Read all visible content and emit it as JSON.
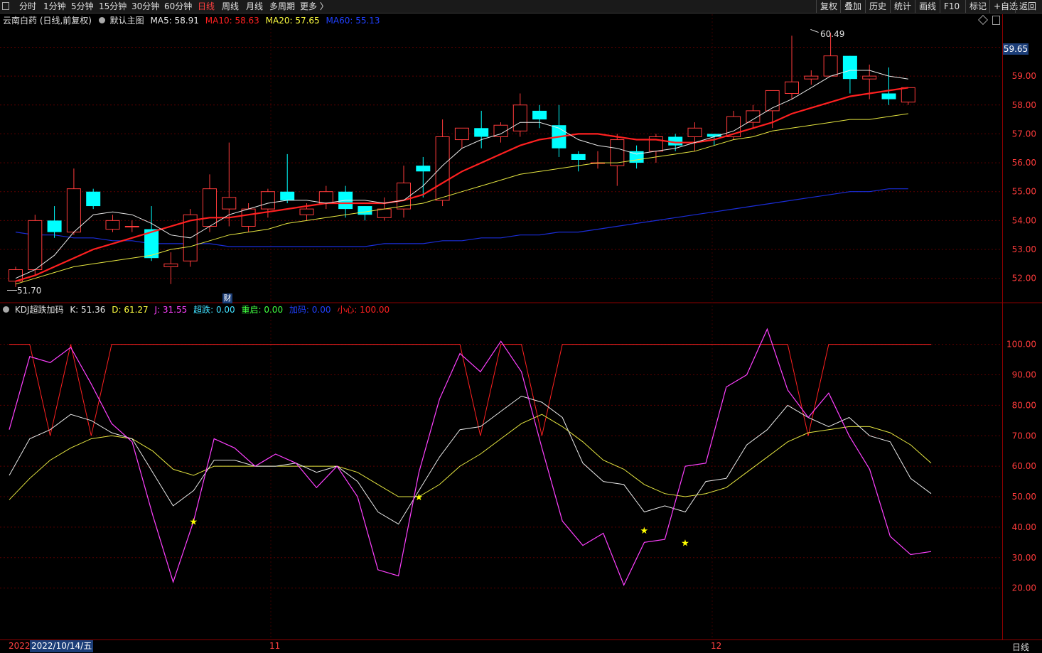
{
  "toolbar": {
    "periods": [
      "分时",
      "1分钟",
      "5分钟",
      "15分钟",
      "30分钟",
      "60分钟",
      "日线",
      "周线",
      "月线",
      "多周期",
      "更多 〉"
    ],
    "active_period": "日线",
    "right_buttons": [
      "复权",
      "叠加",
      "历史",
      "统计",
      "画线",
      "F10",
      "标记",
      "+自选",
      "返回"
    ]
  },
  "main_info": {
    "stock": "云南白药 (日线,前复权)",
    "template": "默认主图",
    "ma5": {
      "label": "MA5: 58.91",
      "color": "#e8e8e8"
    },
    "ma10": {
      "label": "MA10: 58.63",
      "color": "#ff2020"
    },
    "ma20": {
      "label": "MA20: 57.65",
      "color": "#ffff40"
    },
    "ma60": {
      "label": "MA60: 55.13",
      "color": "#2040ff"
    }
  },
  "kdj_info": {
    "title": "KDJ超跌加码",
    "k": {
      "label": "K: 51.36",
      "color": "#e8e8e8"
    },
    "d": {
      "label": "D: 61.27",
      "color": "#ffff40"
    },
    "j": {
      "label": "J: 31.55",
      "color": "#ff40ff"
    },
    "chaodie": {
      "label": "超跌: 0.00",
      "color": "#40e0ff"
    },
    "chongqi": {
      "label": "重启: 0.00",
      "color": "#40ff40"
    },
    "jiama": {
      "label": "加码: 0.00",
      "color": "#2040ff"
    },
    "xiaoxin": {
      "label": "小心: 100.00",
      "color": "#ff2020"
    }
  },
  "price_axis": {
    "ticks": [
      "59.00",
      "58.00",
      "57.00",
      "56.00",
      "55.00",
      "54.00",
      "53.00",
      "52.00"
    ],
    "current_price": "59.65",
    "high_label": "60.49",
    "low_label": "51.70"
  },
  "kdj_axis": {
    "ticks": [
      "100.00",
      "90.00",
      "80.00",
      "70.00",
      "60.00",
      "50.00",
      "40.00",
      "30.00",
      "20.00"
    ]
  },
  "finance_marker": "财",
  "bottom": {
    "start_label": "2022",
    "cursor_date": "2022/10/14/五",
    "month_labels": [
      "11",
      "12"
    ],
    "period_label": "日线"
  },
  "colors": {
    "up": "#ff3b3b",
    "down": "#00ffff",
    "grid": "#5a0000",
    "axis": "#8b0000"
  },
  "chart_data": {
    "type": "candlestick",
    "candles": [
      [
        51.9,
        52.3,
        51.7,
        52.4
      ],
      [
        52.3,
        54.0,
        52.1,
        54.2
      ],
      [
        54.0,
        53.6,
        53.4,
        54.5
      ],
      [
        53.6,
        55.1,
        53.5,
        55.8
      ],
      [
        55.0,
        54.5,
        54.4,
        55.1
      ],
      [
        53.7,
        54.0,
        53.6,
        54.2
      ],
      [
        53.8,
        53.8,
        53.6,
        54.0
      ],
      [
        53.7,
        52.7,
        52.6,
        54.5
      ],
      [
        52.4,
        52.5,
        51.8,
        52.9
      ],
      [
        52.6,
        54.2,
        52.4,
        54.4
      ],
      [
        53.8,
        55.1,
        53.6,
        55.6
      ],
      [
        54.4,
        54.8,
        53.8,
        56.7
      ],
      [
        53.8,
        54.4,
        53.6,
        54.6
      ],
      [
        54.4,
        55.0,
        54.1,
        55.1
      ],
      [
        55.0,
        54.7,
        54.6,
        56.3
      ],
      [
        54.2,
        54.4,
        54.0,
        54.6
      ],
      [
        54.6,
        55.0,
        54.4,
        55.2
      ],
      [
        55.0,
        54.4,
        54.1,
        55.2
      ],
      [
        54.5,
        54.2,
        54.0,
        54.5
      ],
      [
        54.1,
        54.4,
        54.0,
        54.8
      ],
      [
        54.4,
        55.3,
        54.1,
        55.9
      ],
      [
        55.9,
        55.7,
        54.8,
        56.2
      ],
      [
        54.7,
        56.9,
        54.5,
        57.5
      ],
      [
        56.8,
        57.2,
        56.5,
        57.2
      ],
      [
        57.2,
        56.9,
        56.5,
        57.8
      ],
      [
        56.9,
        57.3,
        56.7,
        57.4
      ],
      [
        57.1,
        58.0,
        56.9,
        58.4
      ],
      [
        57.8,
        57.5,
        57.2,
        58.0
      ],
      [
        57.3,
        56.5,
        56.2,
        58.0
      ],
      [
        56.3,
        56.1,
        55.7,
        56.4
      ],
      [
        56.0,
        56.0,
        55.8,
        56.4
      ],
      [
        55.9,
        56.8,
        55.2,
        57.0
      ],
      [
        56.4,
        56.0,
        55.8,
        56.6
      ],
      [
        56.4,
        56.9,
        56.0,
        57.0
      ],
      [
        56.9,
        56.6,
        56.4,
        57.0
      ],
      [
        56.9,
        57.2,
        56.4,
        57.4
      ],
      [
        57.0,
        56.9,
        56.6,
        57.0
      ],
      [
        56.9,
        57.6,
        56.8,
        57.8
      ],
      [
        57.4,
        57.8,
        57.2,
        58.0
      ],
      [
        57.8,
        58.5,
        57.2,
        58.5
      ],
      [
        58.4,
        58.8,
        58.2,
        60.4
      ],
      [
        58.9,
        59.0,
        58.7,
        59.2
      ],
      [
        59.0,
        59.7,
        59.3,
        60.5
      ],
      [
        59.7,
        58.9,
        58.4,
        59.7
      ],
      [
        58.9,
        59.0,
        58.2,
        59.4
      ],
      [
        58.4,
        58.2,
        58.0,
        59.3
      ],
      [
        58.1,
        58.6,
        58.0,
        58.6
      ]
    ],
    "ma5": [
      52.0,
      52.3,
      52.8,
      53.6,
      54.2,
      54.3,
      54.2,
      53.9,
      53.5,
      53.4,
      53.8,
      54.2,
      54.4,
      54.6,
      54.7,
      54.7,
      54.6,
      54.7,
      54.7,
      54.6,
      54.7,
      55.2,
      55.9,
      56.5,
      56.8,
      57.0,
      57.4,
      57.4,
      57.2,
      56.8,
      56.6,
      56.5,
      56.3,
      56.4,
      56.5,
      56.7,
      56.9,
      57.1,
      57.5,
      57.9,
      58.2,
      58.6,
      59.0,
      59.2,
      59.2,
      59.0,
      58.9
    ],
    "ma10": [
      51.9,
      52.1,
      52.4,
      52.7,
      53.0,
      53.2,
      53.4,
      53.6,
      53.8,
      54.0,
      54.1,
      54.1,
      54.2,
      54.3,
      54.4,
      54.5,
      54.6,
      54.6,
      54.6,
      54.6,
      54.7,
      54.9,
      55.3,
      55.7,
      56.0,
      56.3,
      56.6,
      56.8,
      56.9,
      57.0,
      57.0,
      56.9,
      56.8,
      56.8,
      56.7,
      56.7,
      56.8,
      57.0,
      57.2,
      57.4,
      57.7,
      57.9,
      58.1,
      58.3,
      58.4,
      58.5,
      58.6
    ],
    "ma20": [
      51.8,
      52.0,
      52.2,
      52.4,
      52.5,
      52.6,
      52.7,
      52.8,
      53.0,
      53.1,
      53.3,
      53.5,
      53.6,
      53.7,
      53.9,
      54.0,
      54.1,
      54.2,
      54.3,
      54.4,
      54.5,
      54.6,
      54.8,
      55.0,
      55.2,
      55.4,
      55.6,
      55.7,
      55.8,
      55.9,
      56.0,
      56.0,
      56.1,
      56.2,
      56.3,
      56.4,
      56.6,
      56.8,
      56.9,
      57.1,
      57.2,
      57.3,
      57.4,
      57.5,
      57.5,
      57.6,
      57.7
    ],
    "ma60": [
      53.6,
      53.5,
      53.5,
      53.4,
      53.4,
      53.3,
      53.3,
      53.2,
      53.2,
      53.2,
      53.2,
      53.1,
      53.1,
      53.1,
      53.1,
      53.1,
      53.1,
      53.1,
      53.1,
      53.2,
      53.2,
      53.2,
      53.3,
      53.3,
      53.4,
      53.4,
      53.5,
      53.5,
      53.6,
      53.6,
      53.7,
      53.8,
      53.9,
      54.0,
      54.1,
      54.2,
      54.3,
      54.4,
      54.5,
      54.6,
      54.7,
      54.8,
      54.9,
      55.0,
      55.0,
      55.1,
      55.1
    ],
    "kdj_k": [
      57,
      69,
      72,
      77,
      75,
      71,
      69,
      58,
      47,
      52,
      62,
      62,
      60,
      60,
      61,
      58,
      60,
      55,
      45,
      41,
      52,
      63,
      72,
      73,
      78,
      83,
      81,
      76,
      61,
      55,
      54,
      45,
      47,
      45,
      55,
      56,
      67,
      72,
      80,
      76,
      73,
      76,
      70,
      68,
      56,
      51
    ],
    "kdj_d": [
      49,
      56,
      62,
      66,
      69,
      70,
      69,
      65,
      59,
      57,
      60,
      60,
      60,
      60,
      60,
      60,
      60,
      58,
      54,
      50,
      50,
      54,
      60,
      64,
      69,
      74,
      77,
      73,
      68,
      62,
      59,
      54,
      51,
      50,
      51,
      53,
      58,
      63,
      68,
      71,
      72,
      73,
      73,
      71,
      67,
      61
    ],
    "kdj_j": [
      72,
      96,
      94,
      99,
      87,
      74,
      68,
      44,
      22,
      42,
      69,
      66,
      60,
      64,
      61,
      53,
      60,
      50,
      26,
      24,
      58,
      82,
      97,
      91,
      101,
      91,
      66,
      42,
      34,
      38,
      21,
      35,
      36,
      60,
      61,
      86,
      90,
      105,
      85,
      76,
      84,
      70,
      59,
      37,
      31,
      32
    ],
    "xiaoxin": [
      100,
      100,
      70,
      100,
      70,
      100,
      100,
      100,
      100,
      100,
      100,
      100,
      100,
      100,
      100,
      100,
      100,
      100,
      100,
      100,
      100,
      100,
      100,
      70,
      100,
      100,
      70,
      100,
      100,
      100,
      100,
      100,
      100,
      100,
      100,
      100,
      100,
      100,
      100,
      70,
      100,
      100,
      100,
      100,
      100,
      100
    ],
    "stars": [
      {
        "i": 9,
        "v": 42
      },
      {
        "i": 20,
        "v": 50
      },
      {
        "i": 31,
        "v": 39
      },
      {
        "i": 33,
        "v": 35
      }
    ],
    "price_range": [
      51.5,
      60.7
    ],
    "kdj_range": [
      5,
      109
    ]
  }
}
